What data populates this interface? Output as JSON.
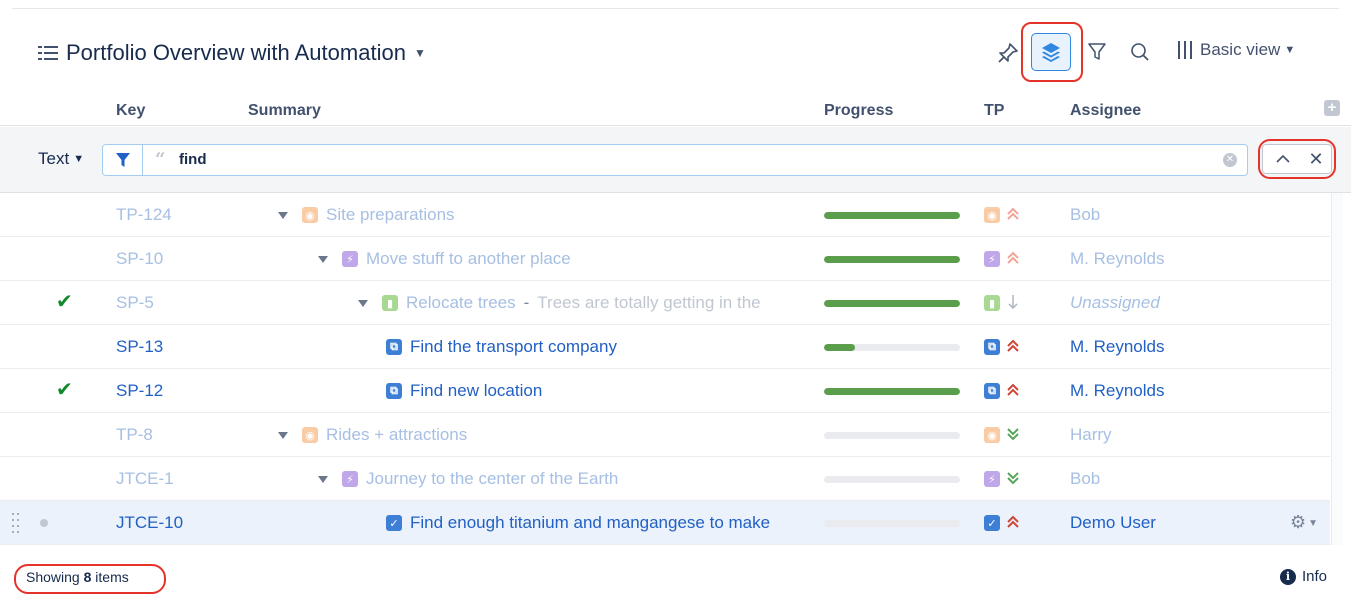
{
  "header": {
    "title": "Portfolio Overview with Automation",
    "view_label": "Basic view"
  },
  "columns": {
    "key": "Key",
    "summary": "Summary",
    "progress": "Progress",
    "tp": "TP",
    "assignee": "Assignee"
  },
  "filter": {
    "mode_label": "Text",
    "query": "find"
  },
  "rows": [
    {
      "key": "TP-124",
      "title": "Site preparations",
      "desc": "",
      "assignee": "Bob",
      "progress": 1.0,
      "level": 0,
      "type_icon": "goal-icon",
      "priority": "highest",
      "checked": false,
      "faded": true
    },
    {
      "key": "SP-10",
      "title": "Move stuff to another place",
      "desc": "",
      "assignee": "M. Reynolds",
      "progress": 1.0,
      "level": 1,
      "type_icon": "epic-icon",
      "priority": "highest",
      "checked": false,
      "faded": true
    },
    {
      "key": "SP-5",
      "title": "Relocate trees",
      "desc": "Trees are totally getting in the",
      "assignee": "Unassigned",
      "progress": 1.0,
      "level": 2,
      "type_icon": "story-icon",
      "priority": "low",
      "checked": true,
      "faded": true
    },
    {
      "key": "SP-13",
      "title": "Find the transport company",
      "desc": "",
      "assignee": "M. Reynolds",
      "progress": 0.23,
      "level": 3,
      "type_icon": "subtask-icon",
      "priority": "highest",
      "checked": false,
      "faded": false
    },
    {
      "key": "SP-12",
      "title": "Find new location",
      "desc": "",
      "assignee": "M. Reynolds",
      "progress": 1.0,
      "level": 3,
      "type_icon": "subtask-icon",
      "priority": "highest",
      "checked": true,
      "faded": false
    },
    {
      "key": "TP-8",
      "title": "Rides + attractions",
      "desc": "",
      "assignee": "Harry",
      "progress": 0.0,
      "level": 0,
      "type_icon": "goal-icon",
      "priority": "lowest",
      "checked": false,
      "faded": true
    },
    {
      "key": "JTCE-1",
      "title": "Journey to the center of the Earth",
      "desc": "",
      "assignee": "Bob",
      "progress": 0.0,
      "level": 1,
      "type_icon": "epic-icon",
      "priority": "lowest",
      "checked": false,
      "faded": true
    },
    {
      "key": "JTCE-10",
      "title": "Find enough titanium and mangangese to make",
      "desc": "",
      "assignee": "Demo User",
      "progress": 0.0,
      "level": 3,
      "type_icon": "task-icon",
      "priority": "highest",
      "checked": false,
      "faded": false,
      "selected": true
    }
  ],
  "footer": {
    "showing_prefix": "Showing",
    "count": "8",
    "showing_suffix": "items",
    "info_label": "Info"
  },
  "colors": {
    "accent": "#2160c4",
    "progress_green": "#5a9e4b",
    "highlight_red": "#e5332a",
    "priority_red": "#d04437",
    "priority_faded_red": "#f2a596",
    "priority_green": "#57a55a",
    "check_green": "#14892c"
  }
}
